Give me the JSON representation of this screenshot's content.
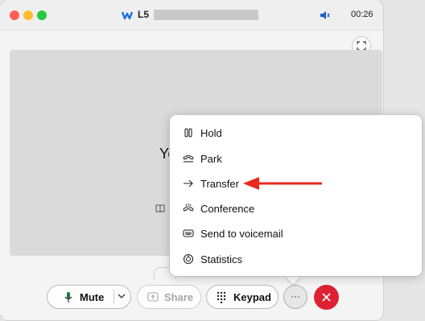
{
  "window": {
    "title": "L5",
    "timer": "00:26"
  },
  "caller": {
    "name_partial": "Yo"
  },
  "controls": {
    "mute_label": "Mute",
    "share_label": "Share",
    "keypad_label": "Keypad",
    "more_label": "···"
  },
  "menu": {
    "items": [
      {
        "label": "Hold",
        "icon": "hold-icon"
      },
      {
        "label": "Park",
        "icon": "park-icon"
      },
      {
        "label": "Transfer",
        "icon": "transfer-arrow-icon"
      },
      {
        "label": "Conference",
        "icon": "conference-icon"
      },
      {
        "label": "Send to voicemail",
        "icon": "voicemail-icon"
      },
      {
        "label": "Statistics",
        "icon": "statistics-icon"
      }
    ]
  },
  "colors": {
    "end_call": "#dd2133",
    "annotation_arrow": "#e8291c",
    "share_disabled": "#a6a6a6"
  }
}
